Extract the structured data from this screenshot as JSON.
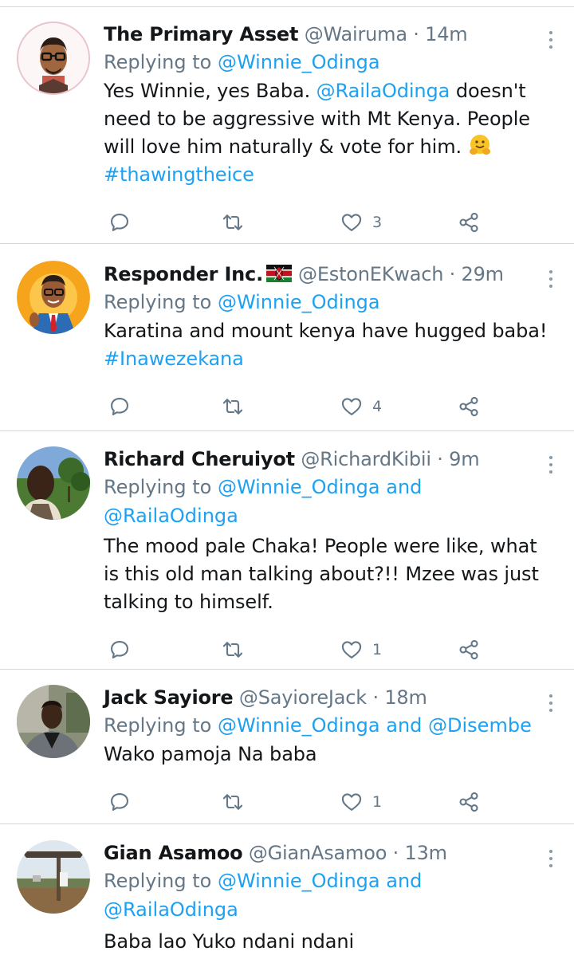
{
  "colors": {
    "link": "#1da1f2",
    "secondary": "#657786",
    "divider": "#d5d8db"
  },
  "tweets": [
    {
      "name": "The Primary Asset",
      "handle": "@Wairuma",
      "time": "14m",
      "replying_prefix": "Replying to ",
      "replying_to": "@Winnie_Odinga",
      "body_1": "Yes Winnie, yes Baba. ",
      "mention": "@RailaOdinga",
      "body_2": " doesn't need to be aggressive with Mt Kenya. People will love him naturally & vote for him. ",
      "hashtag": "#thawingtheice",
      "likes": "3"
    },
    {
      "name": "Responder Inc.",
      "handle": "@EstonEKwach",
      "time": "29m",
      "replying_prefix": "Replying to ",
      "replying_to": "@Winnie_Odinga",
      "body": "Karatina and mount kenya have hugged baba!",
      "hashtag": "#Inawezekana",
      "likes": "4"
    },
    {
      "name": "Richard Cheruiyot",
      "handle": "@RichardKibii",
      "time": "9m",
      "replying_prefix": "Replying to ",
      "replying_to": "@Winnie_Odinga",
      "and": " and ",
      "replying_to_2": "@RailaOdinga",
      "body": "The mood pale Chaka! People were like, what is this old man talking about?!! Mzee was just talking to himself.",
      "likes": "1"
    },
    {
      "name": "Jack Sayiore",
      "handle": "@SayioreJack",
      "time": "18m",
      "replying_prefix": "Replying to ",
      "replying_to": "@Winnie_Odinga",
      "and": " and ",
      "replying_to_2": "@Disembe",
      "body": "Wako pamoja Na baba",
      "likes": "1"
    },
    {
      "name": "Gian Asamoo",
      "handle": "@GianAsamoo",
      "time": "13m",
      "replying_prefix": "Replying to ",
      "replying_to": "@Winnie_Odinga",
      "and": " and ",
      "replying_to_2": "@RailaOdinga",
      "body": "Baba lao Yuko ndani ndani"
    }
  ],
  "separator": " · ",
  "icons": [
    "reply-icon",
    "retweet-icon",
    "like-icon",
    "share-icon",
    "more-icon",
    "kenya-flag-icon",
    "hugging-face-emoji"
  ]
}
